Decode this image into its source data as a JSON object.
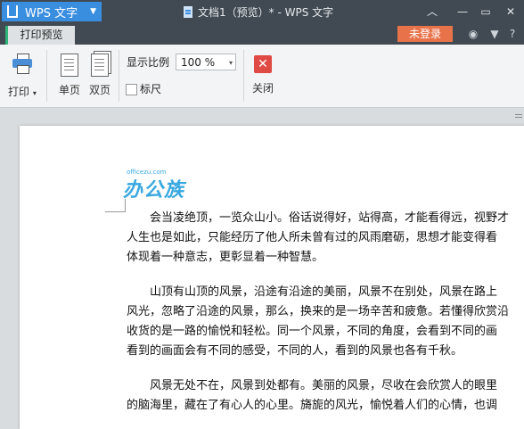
{
  "titlebar": {
    "app_name": "WPS 文字",
    "doc_title": "文档1（预览）* - WPS 文字"
  },
  "tabs": {
    "preview_label": "打印预览",
    "login_label": "未登录"
  },
  "ribbon": {
    "print_label": "打印",
    "single_page_label": "单页",
    "double_page_label": "双页",
    "zoom_label": "显示比例",
    "zoom_value": "100 %",
    "ruler_label": "标尺",
    "close_label": "关闭"
  },
  "document": {
    "watermark_url": "officezu.com",
    "watermark_text": "办公族",
    "para1": [
      "会当凌绝顶，一览众山小。俗话说得好，站得高，才能看得远，视野才",
      "人生也是如此，只能经历了他人所未曾有过的风雨磨砺，思想才能变得看",
      "体现着一种意志，更彰显着一种智慧。"
    ],
    "para2": [
      "山顶有山顶的风景，沿途有沿途的美丽，风景不在别处，风景在路上",
      "风光，忽略了沿途的风景，那么，换来的是一场辛苦和疲惫。若懂得欣赏沿",
      "收货的是一路的愉悦和轻松。同一个风景，不同的角度，会看到不同的画",
      "看到的画面会有不同的感受，不同的人，看到的风景也各有千秋。"
    ],
    "para3": [
      "风景无处不在，风景到处都有。美丽的风景，尽收在会欣赏人的眼里",
      "的脑海里，藏在了有心人的心里。旖旎的风光，愉悦着人们的心情，也调"
    ]
  }
}
